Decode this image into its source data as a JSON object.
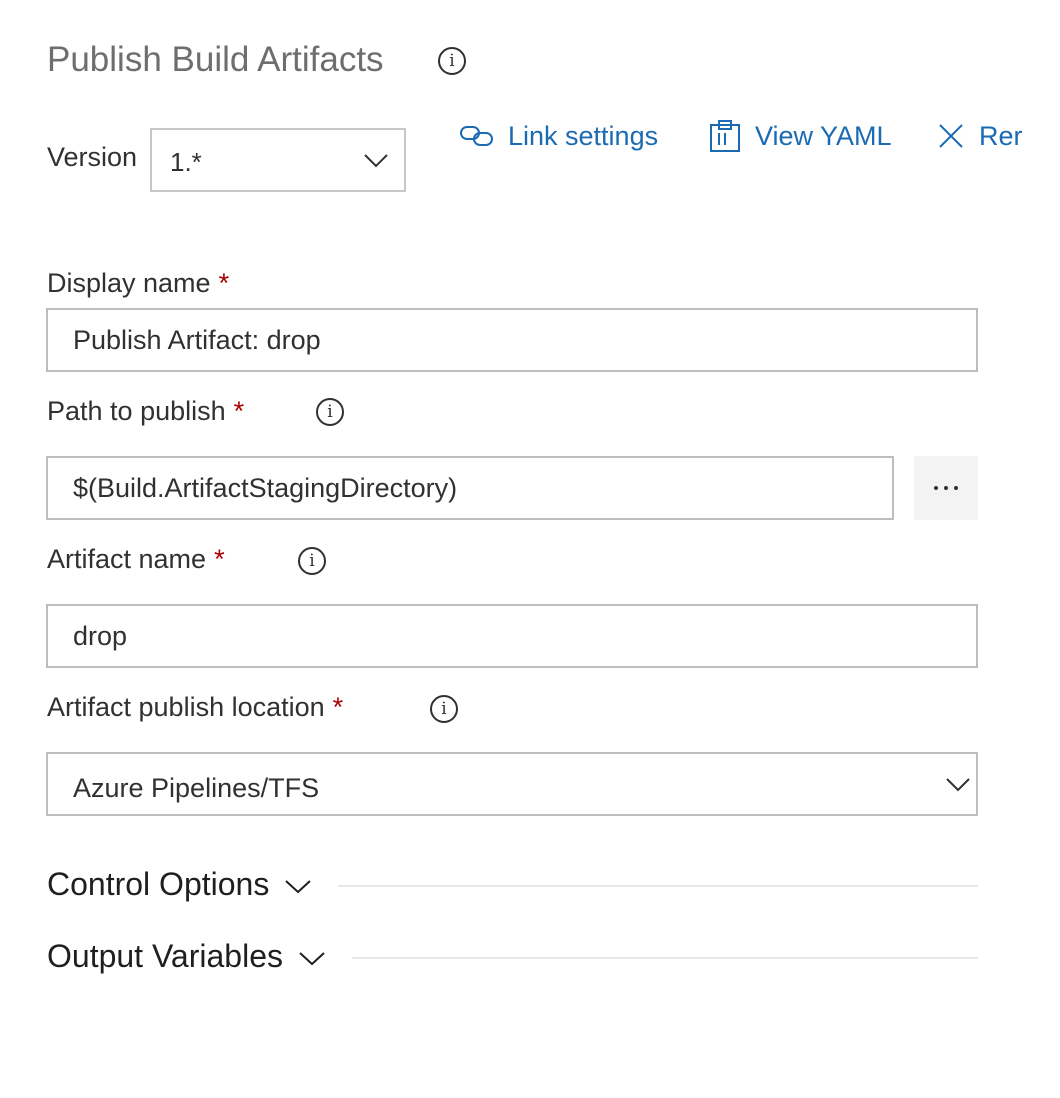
{
  "header": {
    "title": "Publish Build Artifacts",
    "info_icon": "info-icon"
  },
  "version": {
    "label": "Version",
    "value": "1.*"
  },
  "toolbar": {
    "link_settings": "Link settings",
    "view_yaml": "View YAML",
    "remove": "Rer"
  },
  "fields": {
    "display_name": {
      "label": "Display name",
      "required": "*",
      "value": "Publish Artifact: drop"
    },
    "path_to_publish": {
      "label": "Path to publish",
      "required": "*",
      "value": "$(Build.ArtifactStagingDirectory)"
    },
    "artifact_name": {
      "label": "Artifact name",
      "required": "*",
      "value": "drop"
    },
    "publish_location": {
      "label": "Artifact publish location",
      "required": "*",
      "value": "Azure Pipelines/TFS"
    }
  },
  "sections": {
    "control_options": "Control Options",
    "output_variables": "Output Variables"
  },
  "colors": {
    "link": "#1a6bb3",
    "required": "#a80000",
    "title": "#6e6e6e"
  }
}
